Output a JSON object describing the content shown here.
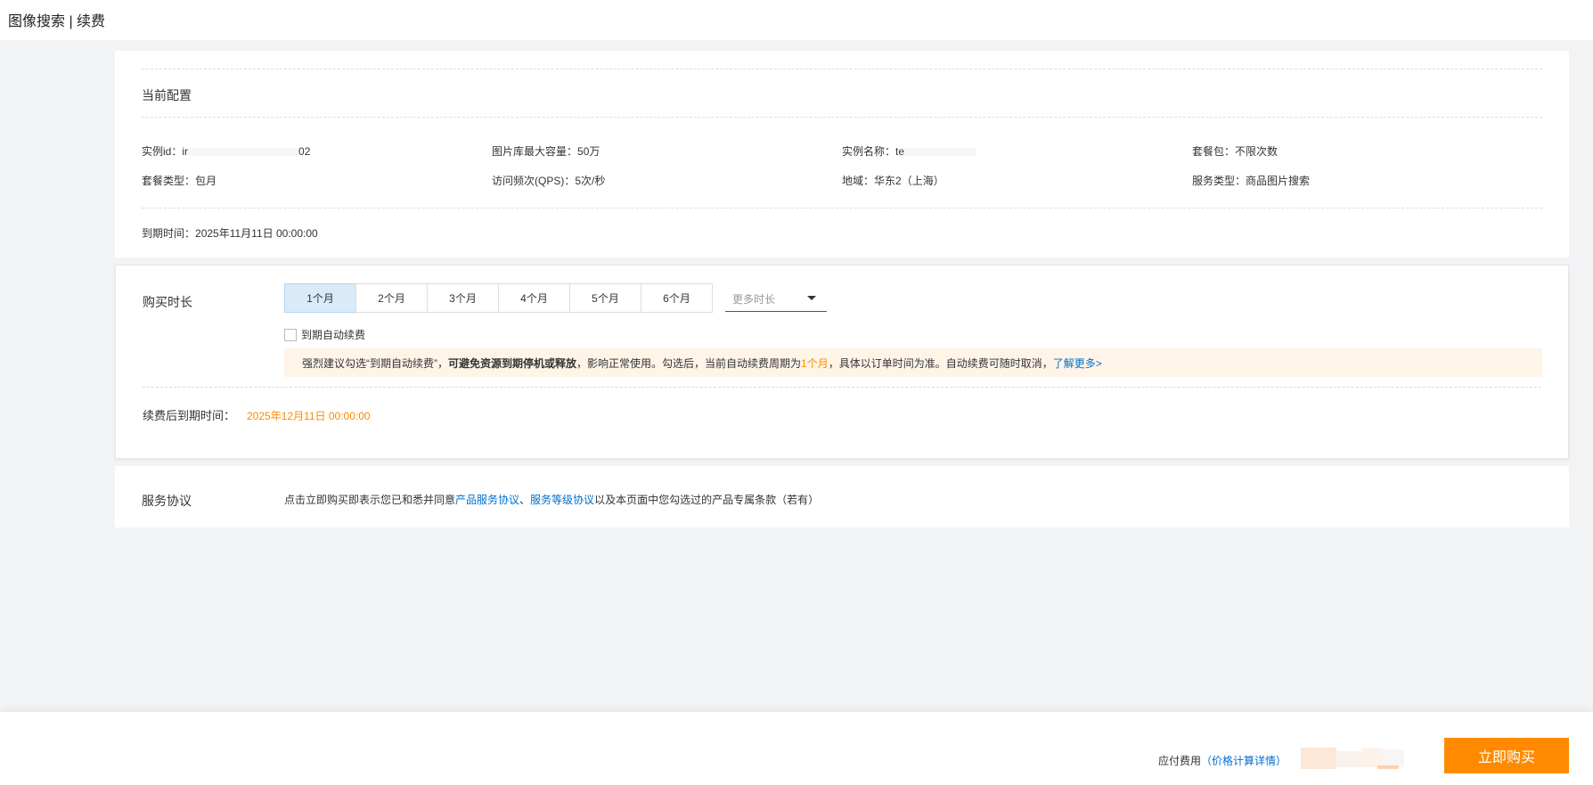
{
  "header": {
    "title": "图像搜索 | 续费"
  },
  "current_config": {
    "section_title": "当前配置",
    "instance_id": {
      "label": "实例id：",
      "value_prefix": "ir",
      "value_suffix": "02"
    },
    "max_capacity": {
      "label": "图片库最大容量：",
      "value": "50万"
    },
    "instance_name": {
      "label": "实例名称：",
      "value_prefix": "te"
    },
    "package": {
      "label": "套餐包：",
      "value": "不限次数"
    },
    "package_type": {
      "label": "套餐类型：",
      "value": "包月"
    },
    "qps": {
      "label": "访问频次(QPS)：",
      "value": "5次/秒"
    },
    "region": {
      "label": "地域：",
      "value": "华东2（上海）"
    },
    "service_type": {
      "label": "服务类型：",
      "value": "商品图片搜索"
    },
    "expire": {
      "label": "到期时间：",
      "value": "2025年11月11日 00:00:00"
    }
  },
  "purchase": {
    "section_title": "购买时长",
    "durations": [
      "1个月",
      "2个月",
      "3个月",
      "4个月",
      "5个月",
      "6个月"
    ],
    "selected_index": 0,
    "more_placeholder": "更多时长",
    "auto_renew_label": "到期自动续费",
    "auto_renew_checked": false,
    "notice": {
      "p1": "强烈建议勾选“到期自动续费”，",
      "bold": "可避免资源到期停机或释放",
      "p2": "，影响正常使用。勾选后，当前自动续费周期为 ",
      "period": "1个月",
      "p3": "，具体以订单时间为准。自动续费可随时取消，",
      "link": "了解更多>"
    },
    "renew_expire_label": "续费后到期时间：",
    "renew_expire_value": "2025年12月11日 00:00:00"
  },
  "agreement": {
    "section_title": "服务协议",
    "text1": "点击立即购买即表示您已和悉并同意",
    "link1": "产品服务协议",
    "sep": "、",
    "link2": "服务等级协议",
    "text2": "以及本页面中您勾选过的产品专属条款（若有）"
  },
  "footer": {
    "fee_label": "应付费用",
    "open_paren": "（",
    "price_detail_link": "价格计算详情",
    "close_paren": "）",
    "buy_button": "立即购买"
  },
  "colors": {
    "accent_orange": "#ff8a00",
    "link_blue": "#0070cc",
    "selected_bg": "#d9ebf8",
    "notice_bg": "#fff4e8"
  }
}
